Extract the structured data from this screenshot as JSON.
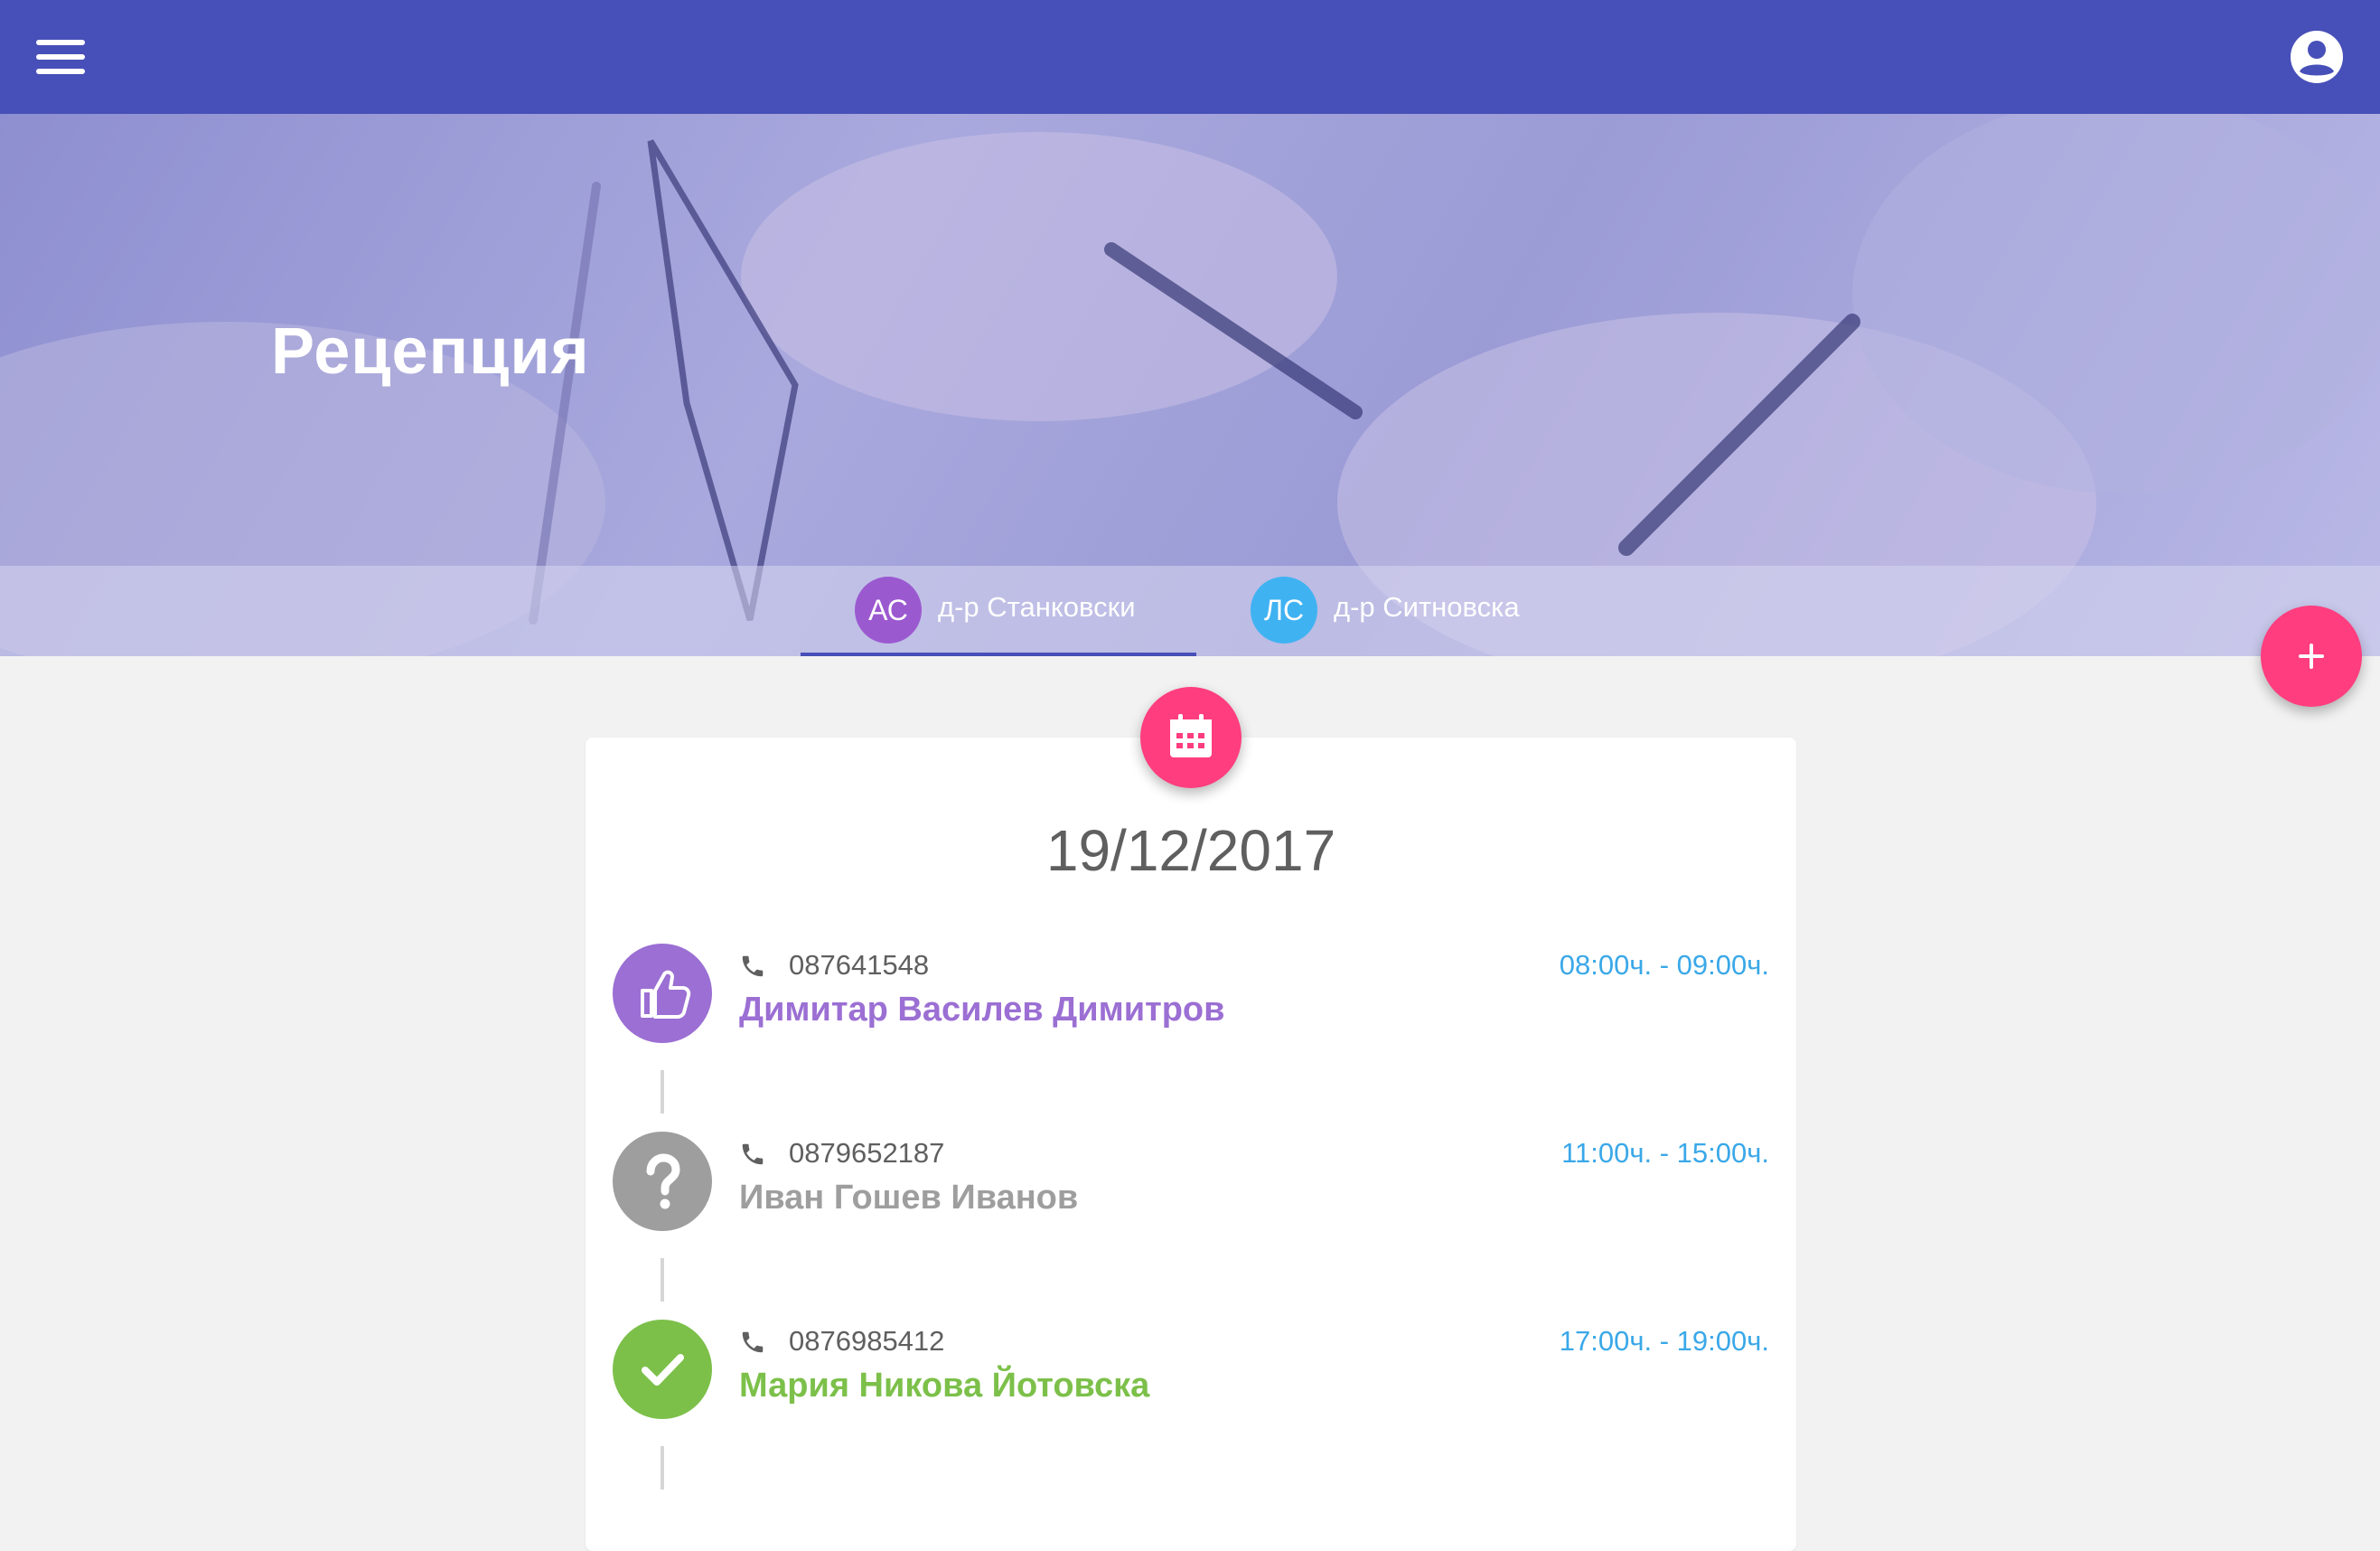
{
  "appbar": {
    "menu_icon": "menu-icon",
    "account_icon": "account-circle-icon",
    "color": "#474fb8"
  },
  "hero": {
    "title": "Рецепция"
  },
  "tabs": [
    {
      "initials": "АС",
      "label": "д-р Станковски",
      "color": "#9b59d0",
      "active": true
    },
    {
      "initials": "ЛС",
      "label": "д-р Ситновска",
      "color": "#3fb2f2",
      "active": false
    }
  ],
  "fab_add_icon": "plus-icon",
  "calendar_icon": "calendar-icon",
  "schedule": {
    "date": "19/12/2017",
    "appointments": [
      {
        "status": "confirmed",
        "icon": "thumbs-up-icon",
        "color": "#9b6fd3",
        "phone": "087641548",
        "name": "Димитар Василев Димитров",
        "time": "08:00ч. - 09:00ч."
      },
      {
        "status": "unknown",
        "icon": "question-mark-icon",
        "color": "#9e9e9e",
        "phone": "0879652187",
        "name": "Иван Гошев Иванов",
        "time": "11:00ч. - 15:00ч."
      },
      {
        "status": "done",
        "icon": "check-icon",
        "color": "#7cc04a",
        "phone": "0876985412",
        "name": "Мария Никова Йотовска",
        "time": "17:00ч. - 19:00ч."
      }
    ]
  },
  "colors": {
    "accent": "#ff3d7f",
    "time": "#3aa8e8"
  }
}
